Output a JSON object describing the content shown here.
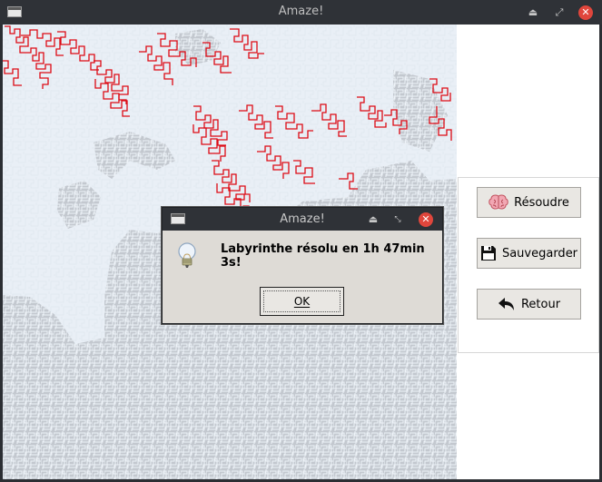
{
  "window": {
    "title": "Amaze!"
  },
  "sidebar": {
    "buttons": [
      {
        "label": "Résoudre",
        "icon": "brain-icon"
      },
      {
        "label": "Sauvegarder",
        "icon": "floppy-disk-icon"
      },
      {
        "label": "Retour",
        "icon": "undo-arrow-icon"
      }
    ]
  },
  "dialog": {
    "title": "Amaze!",
    "message": "Labyrinthe résolu en 1h 47min 3s!",
    "ok_label": "OK",
    "icon": "lightbulb-icon"
  },
  "colors": {
    "path": "#dd0a14",
    "maze_dark": "#a7adb7",
    "maze_light": "#eef3f8",
    "titlebar": "#2f3237",
    "close": "#e0463c"
  }
}
